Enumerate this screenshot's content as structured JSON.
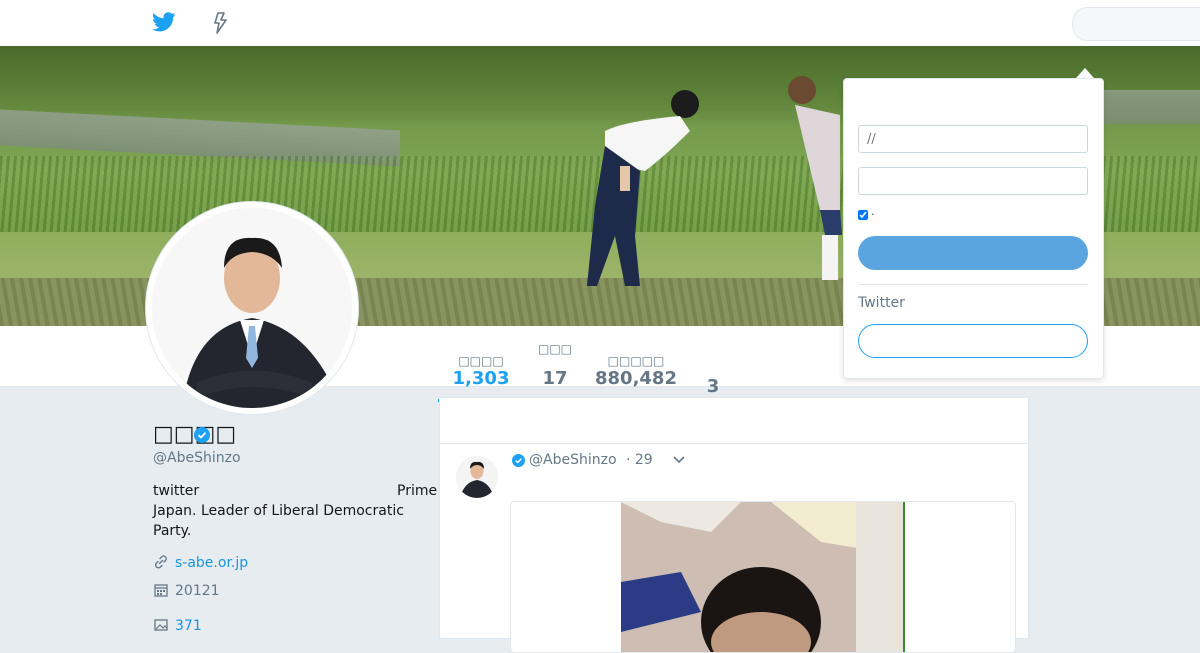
{
  "colors": {
    "accent": "#1da1f2",
    "link": "#1b95e0",
    "muted": "#657786",
    "background": "#e6ecf0"
  },
  "header": {
    "logo_icon": "twitter-bird-icon",
    "moments_icon": "lightning-icon",
    "search_placeholder": ""
  },
  "profile": {
    "name": "□□□□",
    "handle": "@AbeShinzo",
    "verified_icon": "verified-badge-icon",
    "bio_start": "twitter",
    "bio_right": "Prime",
    "bio_rest": "Japan. Leader of Liberal Democratic Party.",
    "website": "s-abe.or.jp",
    "website_icon": "link-icon",
    "joined": "20121",
    "joined_icon": "calendar-icon",
    "media_count": "371",
    "media_icon": "photo-icon"
  },
  "stats": [
    {
      "label": "□□□□",
      "value": "1,303",
      "active": true
    },
    {
      "label": "□□□",
      "value": "17"
    },
    {
      "label": "□□□□□",
      "value": "880,482"
    },
    {
      "label": "",
      "value": "3"
    }
  ],
  "tweet": {
    "handle": "@AbeShinzo",
    "time": "· 29",
    "chevron_icon": "chevron-down-icon"
  },
  "login": {
    "username_placeholder": "//",
    "password_placeholder": "",
    "remember_label": "·",
    "login_button": "",
    "new_to_twitter": "Twitter",
    "signup_button": ""
  }
}
